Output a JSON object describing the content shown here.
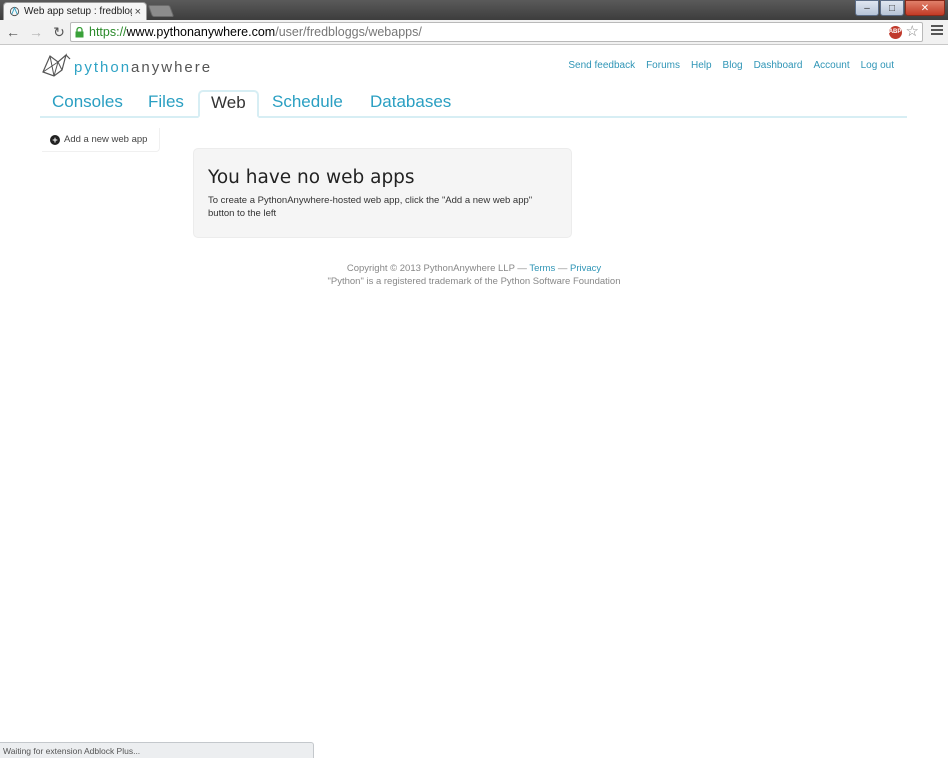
{
  "browser": {
    "tab_title": "Web app setup : fredbloggs",
    "tab_close": "×",
    "url_scheme": "https://",
    "url_host": "www.pythonanywhere.com",
    "url_path": "/user/fredbloggs/webapps/",
    "adblock_label": "ABP",
    "status_text": "Waiting for extension Adblock Plus..."
  },
  "logo": {
    "part1": "python",
    "part2": "anywhere"
  },
  "topnav": [
    "Send feedback",
    "Forums",
    "Help",
    "Blog",
    "Dashboard",
    "Account",
    "Log out"
  ],
  "tabs": [
    "Consoles",
    "Files",
    "Web",
    "Schedule",
    "Databases"
  ],
  "sidebar": {
    "add_label": "Add a new web app"
  },
  "main": {
    "title": "You have no web apps",
    "description": "To create a PythonAnywhere-hosted web app, click the \"Add a new web app\" button to the left"
  },
  "footer": {
    "copyright": "Copyright © 2013 PythonAnywhere LLP —",
    "terms": "Terms",
    "sep": "—",
    "privacy": "Privacy",
    "trademark": "\"Python\" is a registered trademark of the Python Software Foundation"
  },
  "colors": {
    "accent": "#2a9fc2",
    "tab_border": "#d7eef4"
  }
}
